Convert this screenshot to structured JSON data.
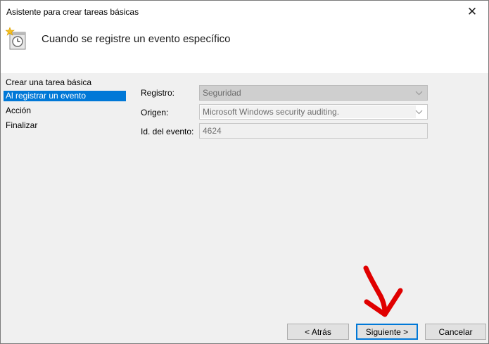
{
  "window": {
    "title": "Asistente para crear tareas básicas",
    "close_glyph": "✕"
  },
  "header": {
    "title": "Cuando se registre un evento específico",
    "icon": "task-scheduler-icon"
  },
  "sidebar": {
    "items": [
      {
        "label": "Crear una tarea básica",
        "active": false
      },
      {
        "label": "Al registrar un evento",
        "active": true
      },
      {
        "label": "Acción",
        "active": false
      },
      {
        "label": "Finalizar",
        "active": false
      }
    ]
  },
  "form": {
    "log": {
      "label": "Registro:",
      "value": "Seguridad"
    },
    "source": {
      "label": "Origen:",
      "value": "Microsoft Windows security auditing."
    },
    "event_id": {
      "label": "Id. del evento:",
      "value": "4624"
    }
  },
  "buttons": {
    "back": "< Atrás",
    "next": "Siguiente >",
    "cancel": "Cancelar"
  },
  "colors": {
    "accent": "#0078d7",
    "annotation_arrow": "#e00000"
  }
}
